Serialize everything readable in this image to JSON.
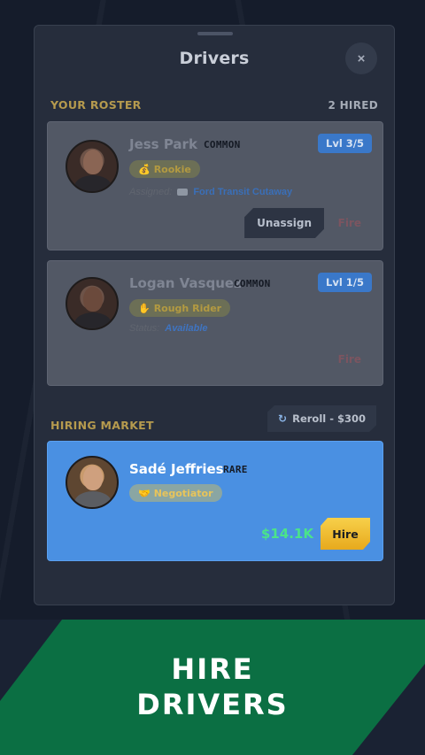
{
  "modal": {
    "title": "Drivers",
    "close_label": "×"
  },
  "roster": {
    "title": "YOUR ROSTER",
    "count": "2 HIRED",
    "drivers": [
      {
        "name": "Jess Park",
        "rarity": "COMMON",
        "level": "Lvl 3/5",
        "trait_icon": "coin-icon",
        "trait_glyph": "💰",
        "trait": "Rookie",
        "assign_label": "Assigned:",
        "vehicle_icon": "van-icon",
        "assignment": "Ford Transit Cutaway",
        "unassign_label": "Unassign",
        "fire_label": "Fire"
      },
      {
        "name": "Logan Vasquez",
        "rarity": "COMMON",
        "level": "Lvl 1/5",
        "trait_icon": "hand-icon",
        "trait_glyph": "✋",
        "trait": "Rough Rider",
        "assign_label": "Status:",
        "assignment": "Available",
        "fire_label": "Fire"
      }
    ]
  },
  "market": {
    "title": "HIRING MARKET",
    "reroll_icon": "refresh-icon",
    "reroll_glyph": "↻",
    "reroll_label": "Reroll - $300",
    "candidates": [
      {
        "name": "Sadé Jeffries",
        "rarity": "RARE",
        "trait_icon": "handshake-icon",
        "trait_glyph": "🤝",
        "trait": "Negotiator",
        "price": "$14.1K",
        "hire_label": "Hire"
      }
    ]
  },
  "banner": {
    "line1": "HIRE",
    "line2": "DRIVERS"
  },
  "colors": {
    "market_card": "#4a90e2",
    "hire": "#f2c230",
    "price": "#4be38a",
    "banner": "#0b6f43",
    "section_title": "#b59a4e"
  }
}
